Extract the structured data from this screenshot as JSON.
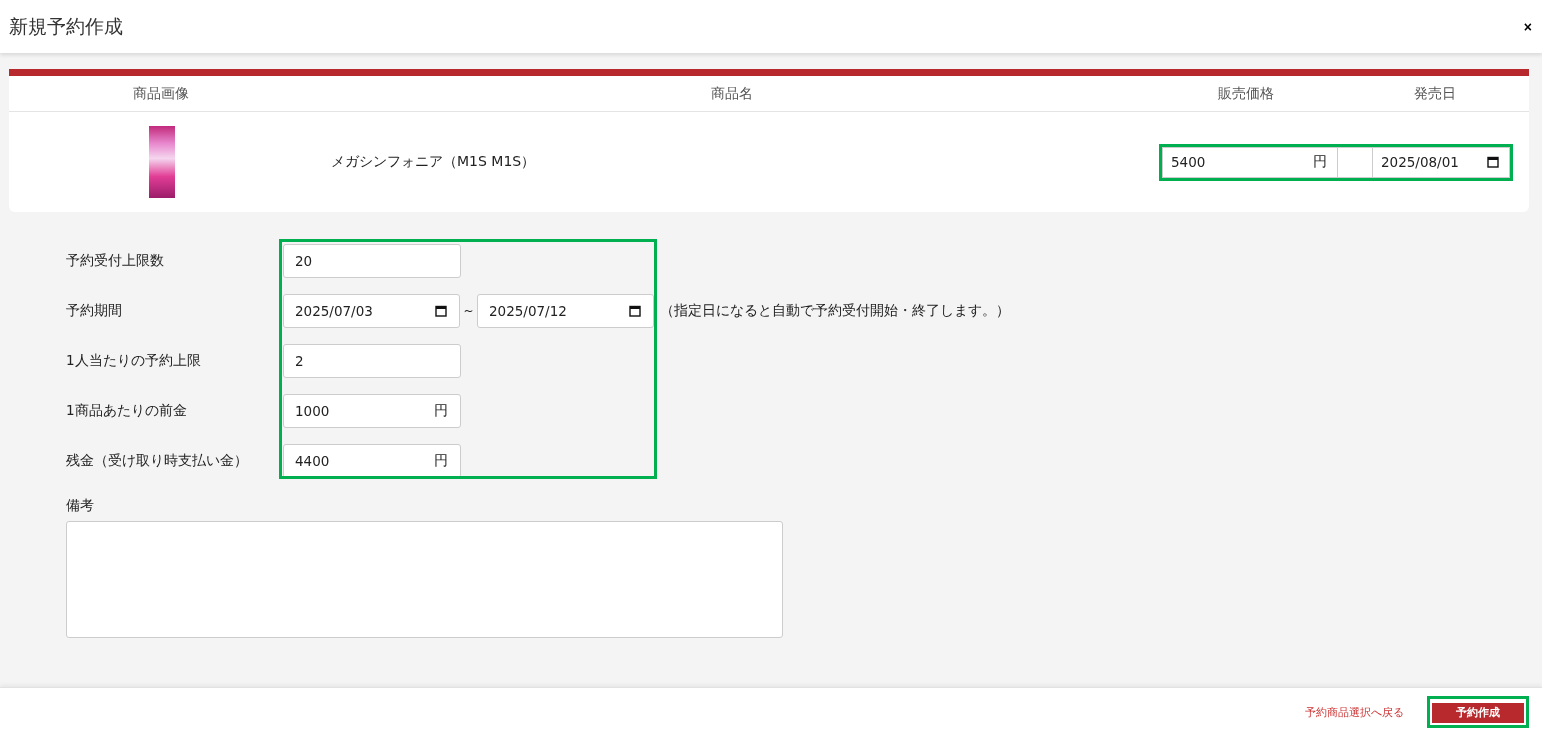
{
  "dialog": {
    "title": "新規予約作成",
    "close": "×"
  },
  "product_table": {
    "columns": [
      "商品画像",
      "商品名",
      "販売価格",
      "発売日"
    ],
    "row": {
      "name": "メガシンフォニア（M1S M1S）",
      "price": "5400",
      "price_unit": "円",
      "release_date": "2025/08/01"
    },
    "highlighted": true
  },
  "form": {
    "highlighted": true,
    "fields": [
      {
        "kind": "number",
        "label": "予約受付上限数",
        "value": "20"
      },
      {
        "kind": "date_range",
        "label": "予約期間",
        "from": "2025/07/03",
        "separator": "~",
        "to": "2025/07/12",
        "note": "（指定日になると自動で予約受付開始・終了します。）"
      },
      {
        "kind": "number",
        "label": "1人当たりの予約上限",
        "value": "2"
      },
      {
        "kind": "currency",
        "label": "1商品あたりの前金",
        "value": "1000",
        "unit": "円"
      },
      {
        "kind": "currency",
        "label": "残金（受け取り時支払い金）",
        "value": "4400",
        "unit": "円"
      }
    ]
  },
  "remarks": {
    "label": "備考"
  },
  "footer": {
    "back_link": "予約商品選択へ戻る",
    "submit_button": {
      "label": "予約作成",
      "highlighted": true
    }
  }
}
